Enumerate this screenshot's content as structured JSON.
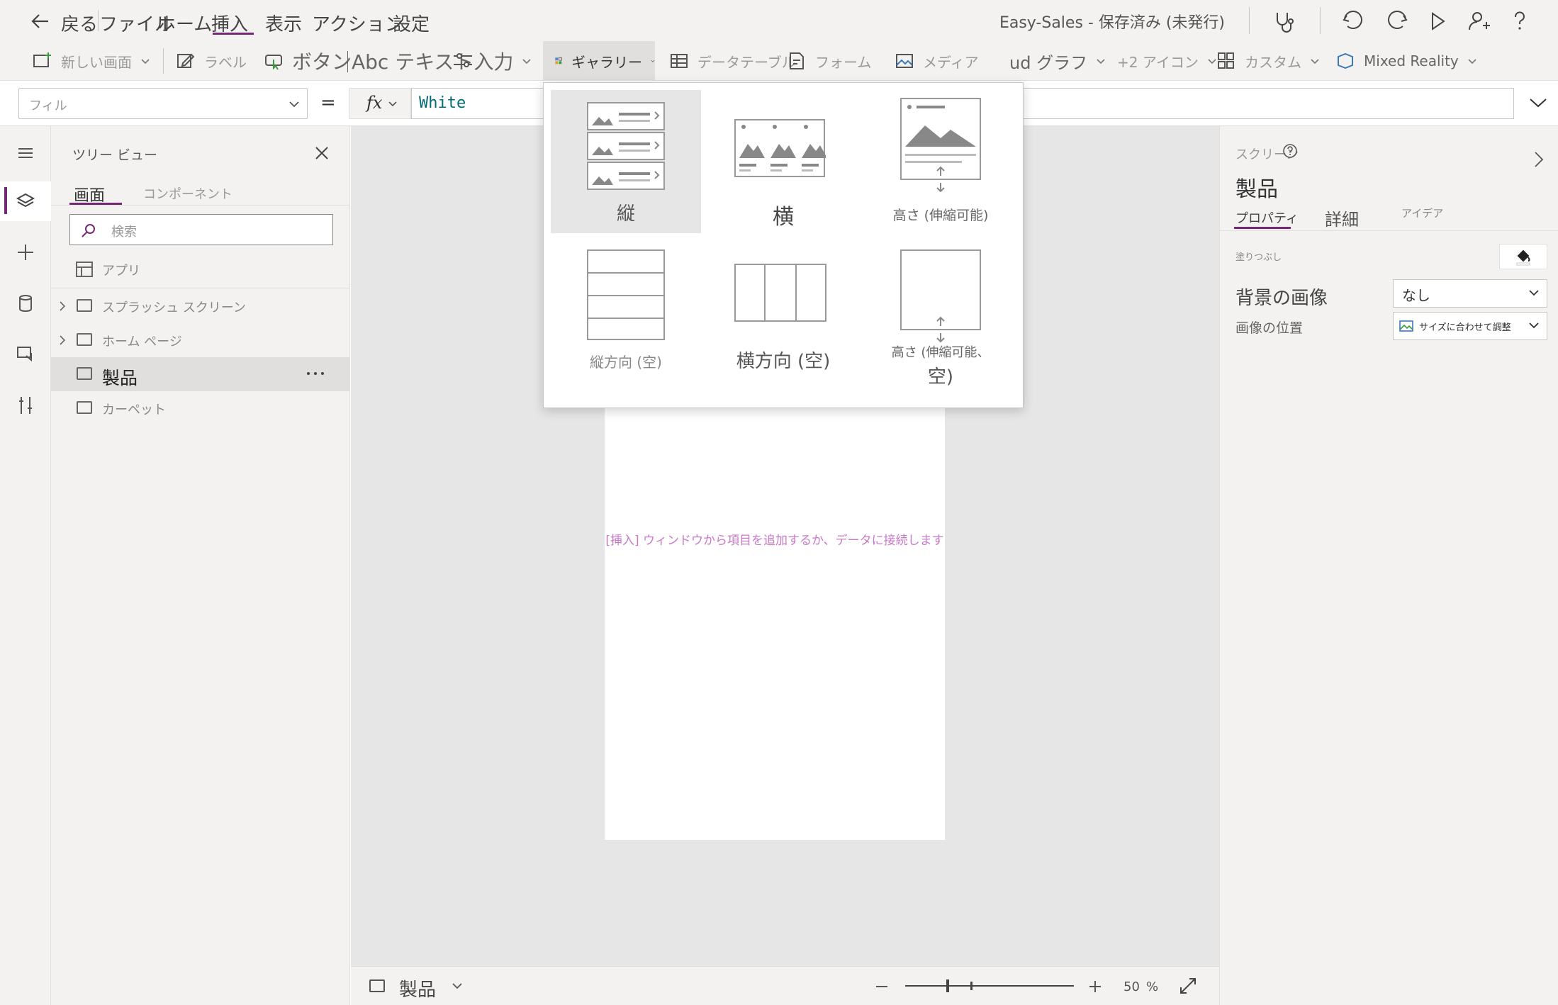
{
  "menubar": {
    "back_label": "戻る",
    "items": [
      "ファイル",
      "ホーム",
      "挿入",
      "表示",
      "アクション",
      "設定"
    ],
    "app_title": "Easy-Sales - 保存済み (未発行)"
  },
  "ribbon": {
    "new_screen": "新しい画面",
    "label": "ラベル",
    "button": "ボタン",
    "text_input": "Abc テキスト入力",
    "gallery": "ギャラリー",
    "data_table": "データテーブル",
    "form": "フォーム",
    "media": "メディア",
    "chart": "ud グラフ",
    "icons": "+2 アイコン",
    "custom": "カスタム",
    "mixed_reality": "Mixed Reality"
  },
  "formula": {
    "property": "フィル",
    "equals": "=",
    "fx": "fx",
    "value": "White"
  },
  "tree": {
    "title": "ツリー ビュー",
    "tabs": [
      "画面",
      "コンポーネント"
    ],
    "search_placeholder": "検索",
    "app_label": "アプリ",
    "items": [
      {
        "label": "スプラッシュ スクリーン"
      },
      {
        "label": "ホーム ページ"
      },
      {
        "label": "製品"
      },
      {
        "label": "カーペット"
      }
    ]
  },
  "canvas": {
    "hint": "[挿入] ウィンドウから項目を追加するか、データに接続します"
  },
  "bottombar": {
    "screen_name": "製品",
    "zoom": "50",
    "zoom_unit": "%"
  },
  "props": {
    "header": "スクリーン",
    "screen_name": "製品",
    "tabs": [
      "プロパティ",
      "詳細",
      "アイデア"
    ],
    "fill_label": "塗りつぶし",
    "bg_image_label": "背景の画像",
    "bg_image_value": "なし",
    "image_position_label": "画像の位置",
    "image_position_value": "サイズに合わせて調整"
  },
  "gallery_menu": {
    "items": [
      {
        "label": "縦"
      },
      {
        "label": "横"
      },
      {
        "label": "高さ (伸縮可能)"
      },
      {
        "label": "縦方向 (空)"
      },
      {
        "label": "横方向 (空)"
      },
      {
        "label": "高さ (伸縮可能、"
      },
      {
        "label": "空)"
      }
    ]
  },
  "colors": {
    "accent": "#742774",
    "hint": "#c879c8",
    "formula_text": "#006d77"
  }
}
